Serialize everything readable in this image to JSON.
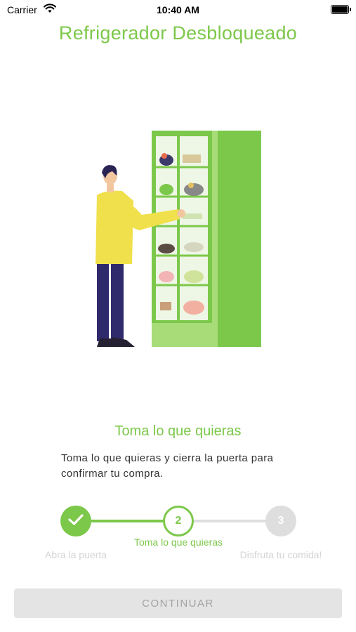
{
  "status_bar": {
    "carrier": "Carrier",
    "time": "10:40 AM"
  },
  "header": {
    "title": "Refrigerador Desbloqueado"
  },
  "illustration": {
    "icon": "person-at-fridge-illustration"
  },
  "instruction": {
    "heading": "Toma lo que quieras",
    "description": "Toma lo que quieras y cierra la puerta para confirmar tu compra."
  },
  "stepper": {
    "current": 2,
    "steps": [
      {
        "label": "Abra la puerta",
        "state": "done",
        "number": "1"
      },
      {
        "label": "Toma lo que quieras",
        "state": "active",
        "number": "2"
      },
      {
        "label": "Disfruta tu comida!",
        "state": "pending",
        "number": "3"
      }
    ]
  },
  "footer": {
    "continue_label": "CONTINUAR"
  },
  "colors": {
    "accent": "#7cc84a",
    "inactive": "#dedede",
    "button_bg": "#e4e4e4",
    "button_text": "#a3a3a3"
  }
}
